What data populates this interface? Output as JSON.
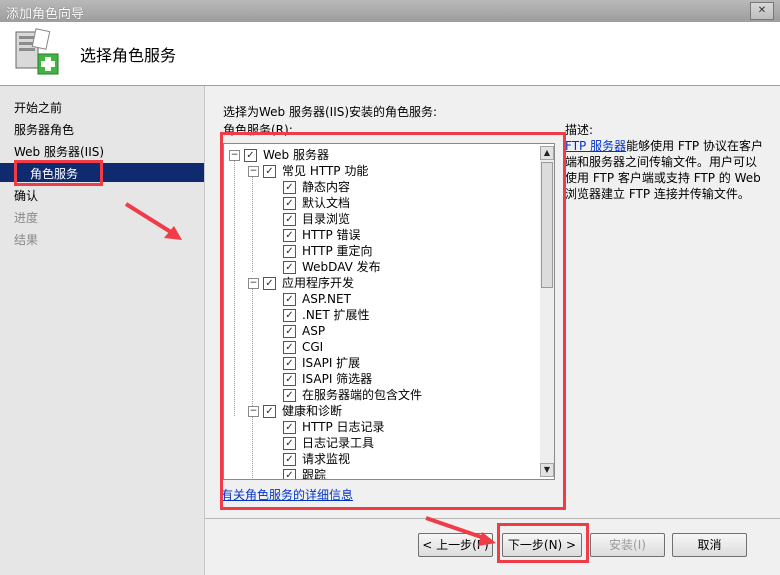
{
  "window": {
    "title": "添加角色向导",
    "close_glyph": "✕"
  },
  "header": {
    "title": "选择角色服务"
  },
  "nav": {
    "items": [
      {
        "label": "开始之前",
        "dim": false
      },
      {
        "label": "服务器角色",
        "dim": false
      },
      {
        "label": "Web 服务器(IIS)",
        "dim": false
      },
      {
        "label": "角色服务",
        "dim": false,
        "selected": true
      },
      {
        "label": "确认",
        "dim": false
      },
      {
        "label": "进度",
        "dim": true
      },
      {
        "label": "结果",
        "dim": true
      }
    ]
  },
  "main": {
    "instruction": "选择为Web 服务器(IIS)安装的角色服务:",
    "services_label": "角色服务(R):",
    "description_label": "描述:",
    "description_link": "FTP 服务器",
    "description_text": "能够使用 FTP 协议在客户端和服务器之间传输文件。用户可以使用 FTP 客户端或支持 FTP 的 Web 浏览器建立 FTP 连接并传输文件。",
    "more_info_link": "有关角色服务的详细信息"
  },
  "tree": [
    {
      "label": "Web 服务器",
      "level": 0,
      "expander": "−",
      "checked": true
    },
    {
      "label": "常见 HTTP 功能",
      "level": 1,
      "expander": "−",
      "checked": true
    },
    {
      "label": "静态内容",
      "level": 2,
      "checked": true
    },
    {
      "label": "默认文档",
      "level": 2,
      "checked": true
    },
    {
      "label": "目录浏览",
      "level": 2,
      "checked": true
    },
    {
      "label": "HTTP 错误",
      "level": 2,
      "checked": true
    },
    {
      "label": "HTTP 重定向",
      "level": 2,
      "checked": true
    },
    {
      "label": "WebDAV 发布",
      "level": 2,
      "checked": true
    },
    {
      "label": "应用程序开发",
      "level": 1,
      "expander": "−",
      "checked": true
    },
    {
      "label": "ASP.NET",
      "level": 2,
      "checked": true
    },
    {
      "label": ".NET 扩展性",
      "level": 2,
      "checked": true
    },
    {
      "label": "ASP",
      "level": 2,
      "checked": true
    },
    {
      "label": "CGI",
      "level": 2,
      "checked": true
    },
    {
      "label": "ISAPI 扩展",
      "level": 2,
      "checked": true
    },
    {
      "label": "ISAPI 筛选器",
      "level": 2,
      "checked": true
    },
    {
      "label": "在服务器端的包含文件",
      "level": 2,
      "checked": true
    },
    {
      "label": "健康和诊断",
      "level": 1,
      "expander": "−",
      "checked": true
    },
    {
      "label": "HTTP 日志记录",
      "level": 2,
      "checked": true
    },
    {
      "label": "日志记录工具",
      "level": 2,
      "checked": true
    },
    {
      "label": "请求监视",
      "level": 2,
      "checked": true
    },
    {
      "label": "跟踪",
      "level": 2,
      "checked": true
    }
  ],
  "check_glyph": "✓",
  "scroll": {
    "up_glyph": "▲",
    "down_glyph": "▼"
  },
  "buttons": {
    "prev": "< 上一步(P)",
    "next": "下一步(N) >",
    "install": "安装(I)",
    "cancel": "取消"
  },
  "colors": {
    "highlight_box": "#f03c46",
    "nav_selected": "#0f2a6e",
    "link": "#0033cc"
  }
}
